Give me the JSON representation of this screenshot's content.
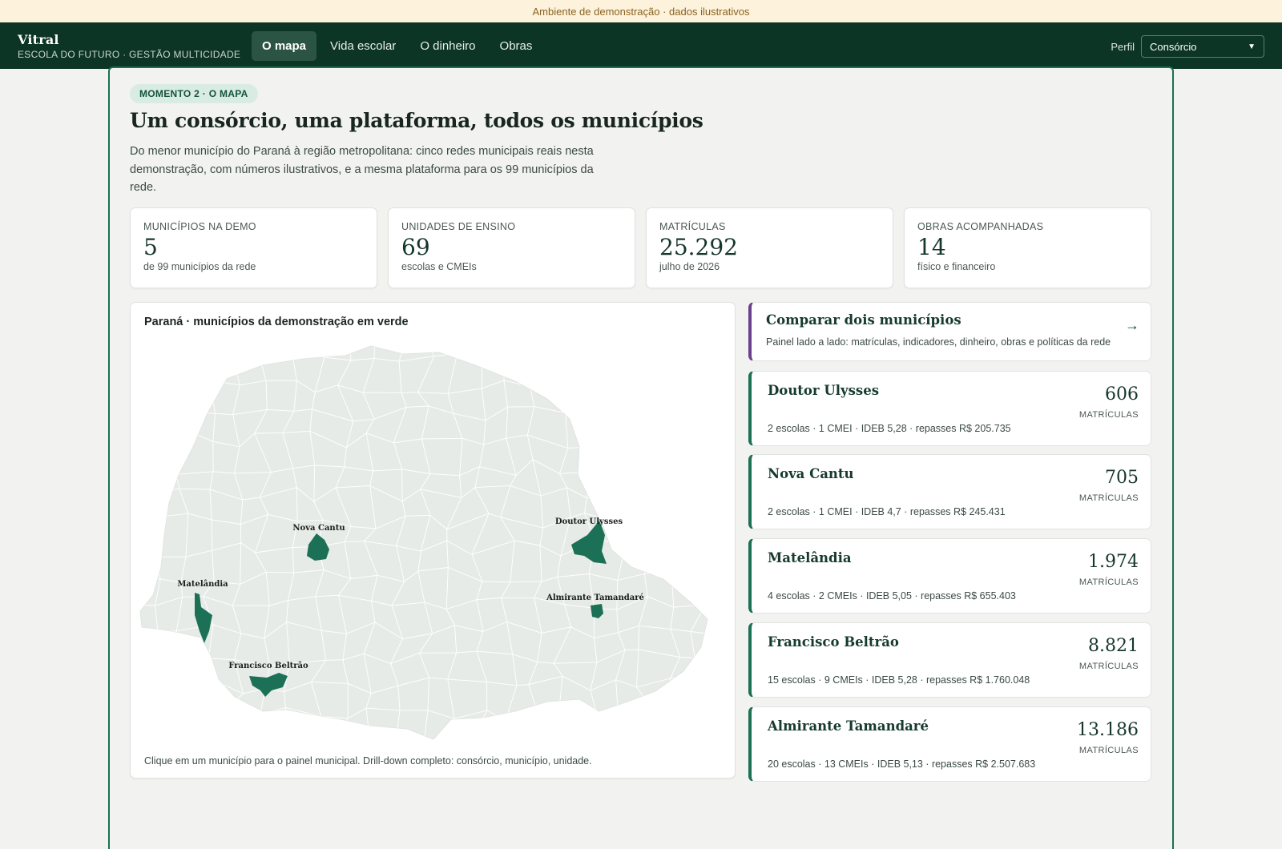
{
  "banner": {
    "text": "Ambiente de demonstração · dados ilustrativos"
  },
  "header": {
    "brand_name": "Vitral",
    "brand_sub": "ESCOLA DO FUTURO · GESTÃO MULTICIDADE",
    "tabs": [
      {
        "label": "O mapa",
        "active": true
      },
      {
        "label": "Vida escolar",
        "active": false
      },
      {
        "label": "O dinheiro",
        "active": false
      },
      {
        "label": "Obras",
        "active": false
      }
    ],
    "profile_label": "Perfil",
    "profile_value": "Consórcio"
  },
  "hero": {
    "pill": "MOMENTO 2 · O MAPA",
    "title": "Um consórcio, uma plataforma, todos os municípios",
    "lede": "Do menor município do Paraná à região metropolitana: cinco redes municipais reais nesta demonstração, com números ilustrativos, e a mesma plataforma para os 99 municípios da rede."
  },
  "stats": [
    {
      "label": "MUNICÍPIOS NA DEMO",
      "value": "5",
      "sub": "de 99 municípios da rede"
    },
    {
      "label": "UNIDADES DE ENSINO",
      "value": "69",
      "sub": "escolas e CMEIs"
    },
    {
      "label": "MATRÍCULAS",
      "value": "25.292",
      "sub": "julho de 2026"
    },
    {
      "label": "OBRAS ACOMPANHADAS",
      "value": "14",
      "sub": "físico e financeiro"
    }
  ],
  "map": {
    "title": "Paraná · municípios da demonstração em verde",
    "footer": "Clique em um município para o painel municipal. Drill-down completo: consórcio, município, unidade.",
    "base_color": "#e7ebe8",
    "highlight_color": "#1b7055",
    "labels": [
      "Nova Cantu",
      "Doutor Ulysses",
      "Matelândia",
      "Almirante Tamandaré",
      "Francisco Beltrão"
    ]
  },
  "compare": {
    "title": "Comparar dois municípios",
    "sub": "Painel lado a lado: matrículas, indicadores, dinheiro, obras e políticas da rede",
    "arrow": "→"
  },
  "municipios": [
    {
      "name": "Doutor Ulysses",
      "value": "606",
      "unit": "MATRÍCULAS",
      "detail": "2 escolas · 1 CMEI · IDEB 5,28 · repasses R$ 205.735"
    },
    {
      "name": "Nova Cantu",
      "value": "705",
      "unit": "MATRÍCULAS",
      "detail": "2 escolas · 1 CMEI · IDEB 4,7 · repasses R$ 245.431"
    },
    {
      "name": "Matelândia",
      "value": "1.974",
      "unit": "MATRÍCULAS",
      "detail": "4 escolas · 2 CMEIs · IDEB 5,05 · repasses R$ 655.403"
    },
    {
      "name": "Francisco Beltrão",
      "value": "8.821",
      "unit": "MATRÍCULAS",
      "detail": "15 escolas · 9 CMEIs · IDEB 5,28 · repasses R$ 1.760.048"
    },
    {
      "name": "Almirante Tamandaré",
      "value": "13.186",
      "unit": "MATRÍCULAS",
      "detail": "20 escolas · 13 CMEIs · IDEB 5,13 · repasses R$ 2.507.683"
    }
  ]
}
